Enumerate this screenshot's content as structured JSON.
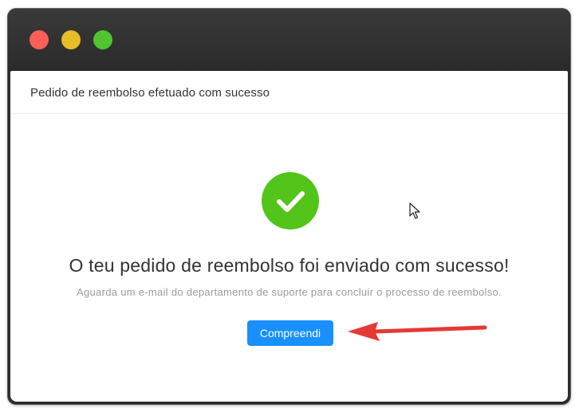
{
  "window": {
    "buttons": {
      "close_color": "#fe5f57",
      "minimize_color": "#e6be2a",
      "zoom_color": "#4fc52f"
    }
  },
  "dialog": {
    "title": "Pedido de reembolso efetuado com sucesso",
    "icon": "check-circle-icon",
    "icon_color": "#52c41a",
    "message": "O teu pedido de reembolso foi enviado com sucesso!",
    "submessage": "Aguarda um e-mail do departamento de suporte para concluir o processo de reembolso.",
    "button_label": "Compreendi",
    "button_color": "#1890ff"
  },
  "annotation": {
    "arrow_icon": "red-arrow-icon",
    "arrow_color": "#e53935"
  },
  "pointer_icon": "mouse-cursor-icon"
}
